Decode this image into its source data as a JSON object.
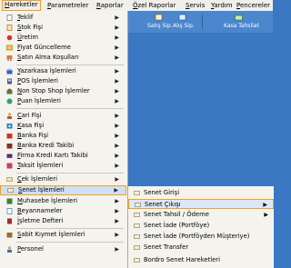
{
  "menubar": {
    "items": [
      "Hareketler",
      "Parametreler",
      "Raporlar",
      "Özel Raporlar",
      "Servis",
      "Yardım",
      "Pencereler"
    ]
  },
  "toolbar": {
    "buttons": [
      "Satış Sip.",
      "Alış Sip.",
      "Kasa Tahsilat"
    ]
  },
  "menu": {
    "items": [
      {
        "label": "Teklif",
        "icon": "document-icon"
      },
      {
        "label": "Stok Fişi",
        "icon": "document-icon"
      },
      {
        "label": "Üretim",
        "icon": "gear-icon"
      },
      {
        "label": "Fiyat Güncelleme",
        "icon": "price-icon"
      },
      {
        "label": "Satın Alma Koşulları",
        "icon": "cart-icon"
      },
      {
        "label": "Yazarkasa İşlemleri",
        "icon": "cash-register-icon"
      },
      {
        "label": "POS İşlemleri",
        "icon": "pos-icon"
      },
      {
        "label": "Non Stop Shop İşlemler",
        "icon": "shop-icon"
      },
      {
        "label": "Puan İşlemleri",
        "icon": "points-icon"
      },
      {
        "label": "Cari Fişi",
        "icon": "person-icon"
      },
      {
        "label": "Kasa Fişi",
        "icon": "safe-icon"
      },
      {
        "label": "Banka Fişi",
        "icon": "bank-icon"
      },
      {
        "label": "Banka Kredi Takibi",
        "icon": "bank-credit-icon"
      },
      {
        "label": "Firma Kredi Kartı Takibi",
        "icon": "credit-card-icon"
      },
      {
        "label": "Taksit İşlemleri",
        "icon": "installment-icon"
      },
      {
        "label": "Çek İşlemleri",
        "icon": "check-icon"
      },
      {
        "label": "Senet İşlemleri",
        "icon": "bond-icon"
      },
      {
        "label": "Muhasebe İşlemleri",
        "icon": "accounting-icon"
      },
      {
        "label": "Beyannameler",
        "icon": "declaration-icon"
      },
      {
        "label": "İşletme Defteri",
        "icon": "ledger-icon"
      },
      {
        "label": "Sabit Kıymet İşlemleri",
        "icon": "asset-icon"
      },
      {
        "label": "Personel",
        "icon": "personnel-icon"
      }
    ]
  },
  "submenu": {
    "items": [
      "Senet Girişi",
      "Senet Çıkışı",
      "Senet Tahsil / Ödeme",
      "Senet İade (Portföye)",
      "Senet İade (Portföyden Müşteriye)",
      "Senet Transfer",
      "Bordro Senet Hareketleri"
    ]
  }
}
